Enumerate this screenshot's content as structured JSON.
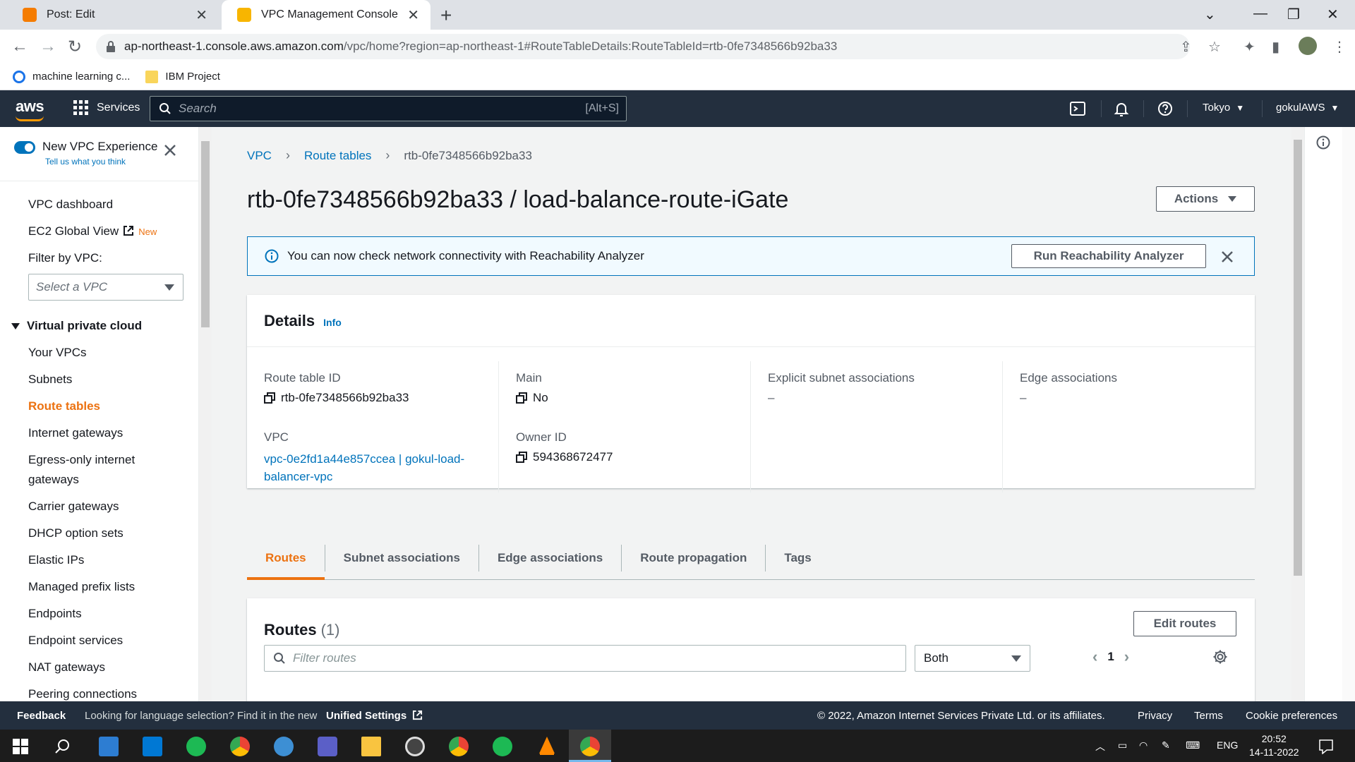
{
  "browser": {
    "tabs": [
      {
        "title": "Post: Edit",
        "active": false
      },
      {
        "title": "VPC Management Console",
        "active": true
      }
    ],
    "url_host": "ap-northeast-1.console.aws.amazon.com",
    "url_path": "/vpc/home?region=ap-northeast-1#RouteTableDetails:RouteTableId=rtb-0fe7348566b92ba33",
    "bookmarks": [
      "machine learning c...",
      "IBM Project"
    ]
  },
  "aws_nav": {
    "logo": "aws",
    "services_label": "Services",
    "search_placeholder": "Search",
    "search_shortcut": "[Alt+S]",
    "region": "Tokyo",
    "account": "gokulAWS"
  },
  "sidebar": {
    "toggle_title": "New VPC Experience",
    "toggle_subtitle": "Tell us what you think",
    "dashboard": "VPC dashboard",
    "ec2_global_view": "EC2 Global View",
    "new_badge": "New",
    "filter_label": "Filter by VPC:",
    "select_placeholder": "Select a VPC",
    "section_title": "Virtual private cloud",
    "items": [
      {
        "label": "Your VPCs"
      },
      {
        "label": "Subnets"
      },
      {
        "label": "Route tables"
      },
      {
        "label": "Internet gateways"
      },
      {
        "label": "Egress-only internet"
      },
      {
        "label": "gateways"
      },
      {
        "label": "Carrier gateways"
      },
      {
        "label": "DHCP option sets"
      },
      {
        "label": "Elastic IPs"
      },
      {
        "label": "Managed prefix lists"
      },
      {
        "label": "Endpoints"
      },
      {
        "label": "Endpoint services"
      },
      {
        "label": "NAT gateways"
      },
      {
        "label": "Peering connections"
      }
    ]
  },
  "breadcrumb": {
    "vpc": "VPC",
    "route_tables": "Route tables",
    "current": "rtb-0fe7348566b92ba33"
  },
  "page": {
    "title": "rtb-0fe7348566b92ba33 / load-balance-route-iGate",
    "actions_label": "Actions"
  },
  "flash": {
    "message": "You can now check network connectivity with Reachability Analyzer",
    "button": "Run Reachability Analyzer"
  },
  "details": {
    "title": "Details",
    "info": "Info",
    "route_table_id_label": "Route table ID",
    "route_table_id": "rtb-0fe7348566b92ba33",
    "vpc_label": "VPC",
    "vpc_value_line1": "vpc-0e2fd1a44e857ccea | gokul-load-",
    "vpc_value_line2": "balancer-vpc",
    "main_label": "Main",
    "main_value": "No",
    "owner_label": "Owner ID",
    "owner_value": "594368672477",
    "explicit_label": "Explicit subnet associations",
    "explicit_value": "–",
    "edge_label": "Edge associations",
    "edge_value": "–"
  },
  "tabs": [
    "Routes",
    "Subnet associations",
    "Edge associations",
    "Route propagation",
    "Tags"
  ],
  "routes": {
    "title": "Routes",
    "count": "(1)",
    "edit_button": "Edit routes",
    "filter_placeholder": "Filter routes",
    "select_value": "Both",
    "page": "1"
  },
  "footer": {
    "feedback": "Feedback",
    "lang_text": "Looking for language selection? Find it in the new",
    "unified": "Unified Settings",
    "copyright": "© 2022, Amazon Internet Services Private Ltd. or its affiliates.",
    "privacy": "Privacy",
    "terms": "Terms",
    "cookies": "Cookie preferences"
  },
  "taskbar": {
    "lang": "ENG",
    "time": "20:52",
    "date": "14-11-2022"
  }
}
